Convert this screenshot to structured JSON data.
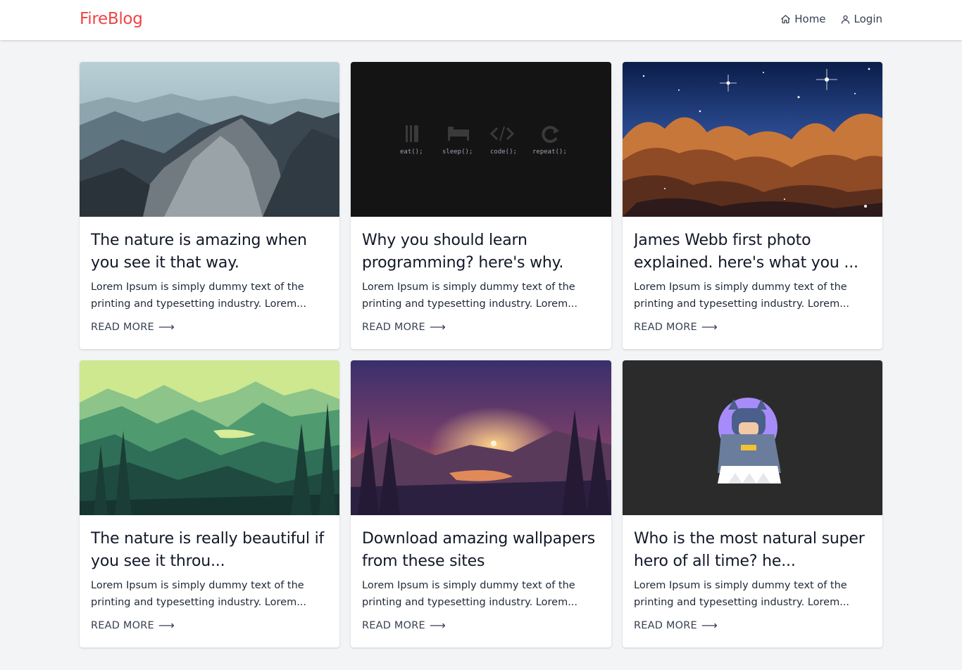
{
  "nav": {
    "brand": "FireBlog",
    "links": [
      {
        "label": "Home",
        "icon": "home-icon"
      },
      {
        "label": "Login",
        "icon": "user-icon"
      }
    ]
  },
  "colors": {
    "brand": "#ef4444",
    "background": "#f3f4f6",
    "card": "#ffffff"
  },
  "posts": [
    {
      "title": "The nature is amazing when you see it that way.",
      "excerpt": "Lorem Ipsum is simply dummy text of the printing and typesetting industry. Lorem...",
      "read_more": "READ MORE",
      "image": "mountains-photo"
    },
    {
      "title": "Why you should learn programming? here's why.",
      "excerpt": "Lorem Ipsum is simply dummy text of the printing and typesetting industry. Lorem...",
      "read_more": "READ MORE",
      "image": "eat-sleep-code-repeat",
      "code_labels": [
        "eat();",
        "sleep();",
        "code();",
        "repeat();"
      ]
    },
    {
      "title": "James Webb first photo explained. here's what you ...",
      "excerpt": "Lorem Ipsum is simply dummy text of the printing and typesetting industry. Lorem...",
      "read_more": "READ MORE",
      "image": "nebula-photo"
    },
    {
      "title": "The nature is really beautiful if you see it throu...",
      "excerpt": "Lorem Ipsum is simply dummy text of the printing and typesetting industry. Lorem...",
      "read_more": "READ MORE",
      "image": "green-forest-illustration"
    },
    {
      "title": "Download amazing wallpapers from these sites",
      "excerpt": "Lorem Ipsum is simply dummy text of the printing and typesetting industry. Lorem...",
      "read_more": "READ MORE",
      "image": "sunset-lake-illustration"
    },
    {
      "title": "Who is the most natural super hero of all time? he...",
      "excerpt": "Lorem Ipsum is simply dummy text of the printing and typesetting industry. Lorem...",
      "read_more": "READ MORE",
      "image": "batman-illustration"
    }
  ]
}
